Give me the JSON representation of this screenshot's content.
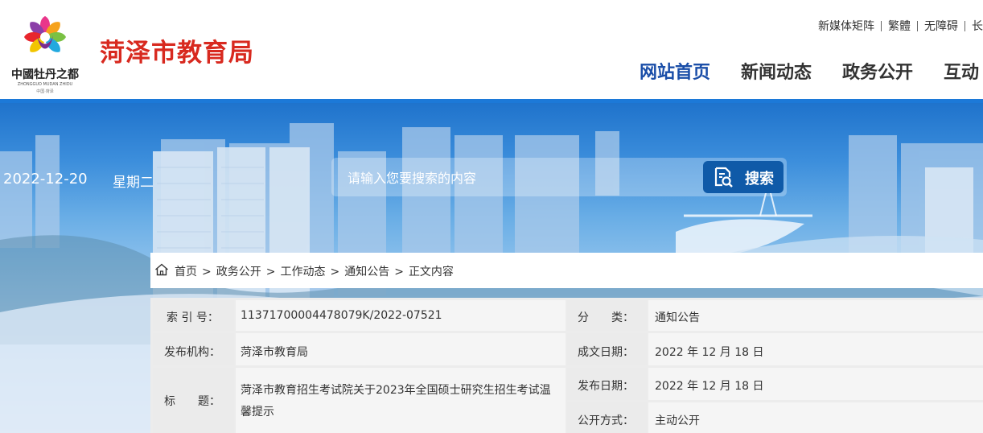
{
  "header": {
    "logo_text": "中國牡丹之都",
    "logo_subtext": "ZHONGGUO MUDAN ZHIDU",
    "logo_caption": "中国·菏泽",
    "site_title": "菏泽市教育局",
    "top_links": [
      "新媒体矩阵",
      "繁體",
      "无障碍",
      "长"
    ],
    "nav": [
      "网站首页",
      "新闻动态",
      "政务公开",
      "互动"
    ]
  },
  "banner": {
    "date": "2022-12-20",
    "weekday": "星期二",
    "search_placeholder": "请输入您要搜索的内容",
    "search_button": "搜索"
  },
  "breadcrumb": [
    "首页",
    "政务公开",
    "工作动态",
    "通知公告",
    "正文内容"
  ],
  "meta": {
    "index_label": "索 引 号：",
    "index_value": "11371700004478079K/2022-07521",
    "category_label": "分　　类：",
    "category_value": "通知公告",
    "publisher_label": "发布机构：",
    "publisher_value": "菏泽市教育局",
    "created_label": "成文日期：",
    "created_value": "2022 年 12 月 18 日",
    "title_label": "标　　题：",
    "title_value": "菏泽市教育招生考试院关于2023年全国硕士研究生招生考试温馨提示",
    "published_label": "发布日期：",
    "published_value": "2022 年 12 月 18 日",
    "open_label": "公开方式：",
    "open_value": "主动公开"
  },
  "colors": {
    "brand_red": "#d8291f",
    "nav_active": "#1a4ea8",
    "accent_blue": "#1c79d8"
  }
}
